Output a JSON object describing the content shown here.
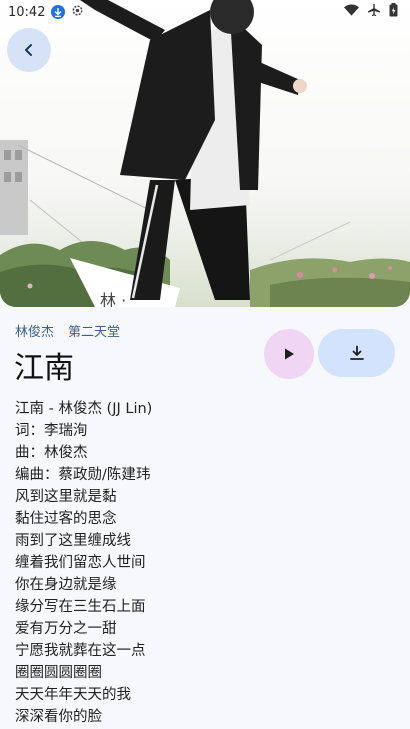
{
  "status_bar": {
    "time": "10:42",
    "icons": [
      "download-status-icon",
      "settings-status-icon",
      "wifi-icon",
      "airplane-icon",
      "battery-icon"
    ]
  },
  "header": {
    "back_icon": "chevron-left-icon"
  },
  "song": {
    "artist": "林俊杰",
    "album": "第二天堂",
    "title": "江南"
  },
  "actions": {
    "play_icon": "play-icon",
    "download_icon": "download-icon"
  },
  "lyrics": [
    "江南 - 林俊杰 (JJ Lin)",
    "词：李瑞洵",
    "曲：林俊杰",
    "编曲：蔡政勋/陈建玮",
    "风到这里就是黏",
    "黏住过客的思念",
    "雨到了这里缠成线",
    "缠着我们留恋人世间",
    "你在身边就是缘",
    "缘分写在三生石上面",
    "爱有万分之一甜",
    "宁愿我就葬在这一点",
    "圈圈圆圆圈圈",
    "天天年年天天的我",
    "深深看你的脸"
  ],
  "colors": {
    "background": "#f6f8fc",
    "back_button": "#d6e3f7",
    "play_button": "#f0d5f5",
    "download_button": "#d3e3fd",
    "artist_link": "#3b5f8f"
  }
}
